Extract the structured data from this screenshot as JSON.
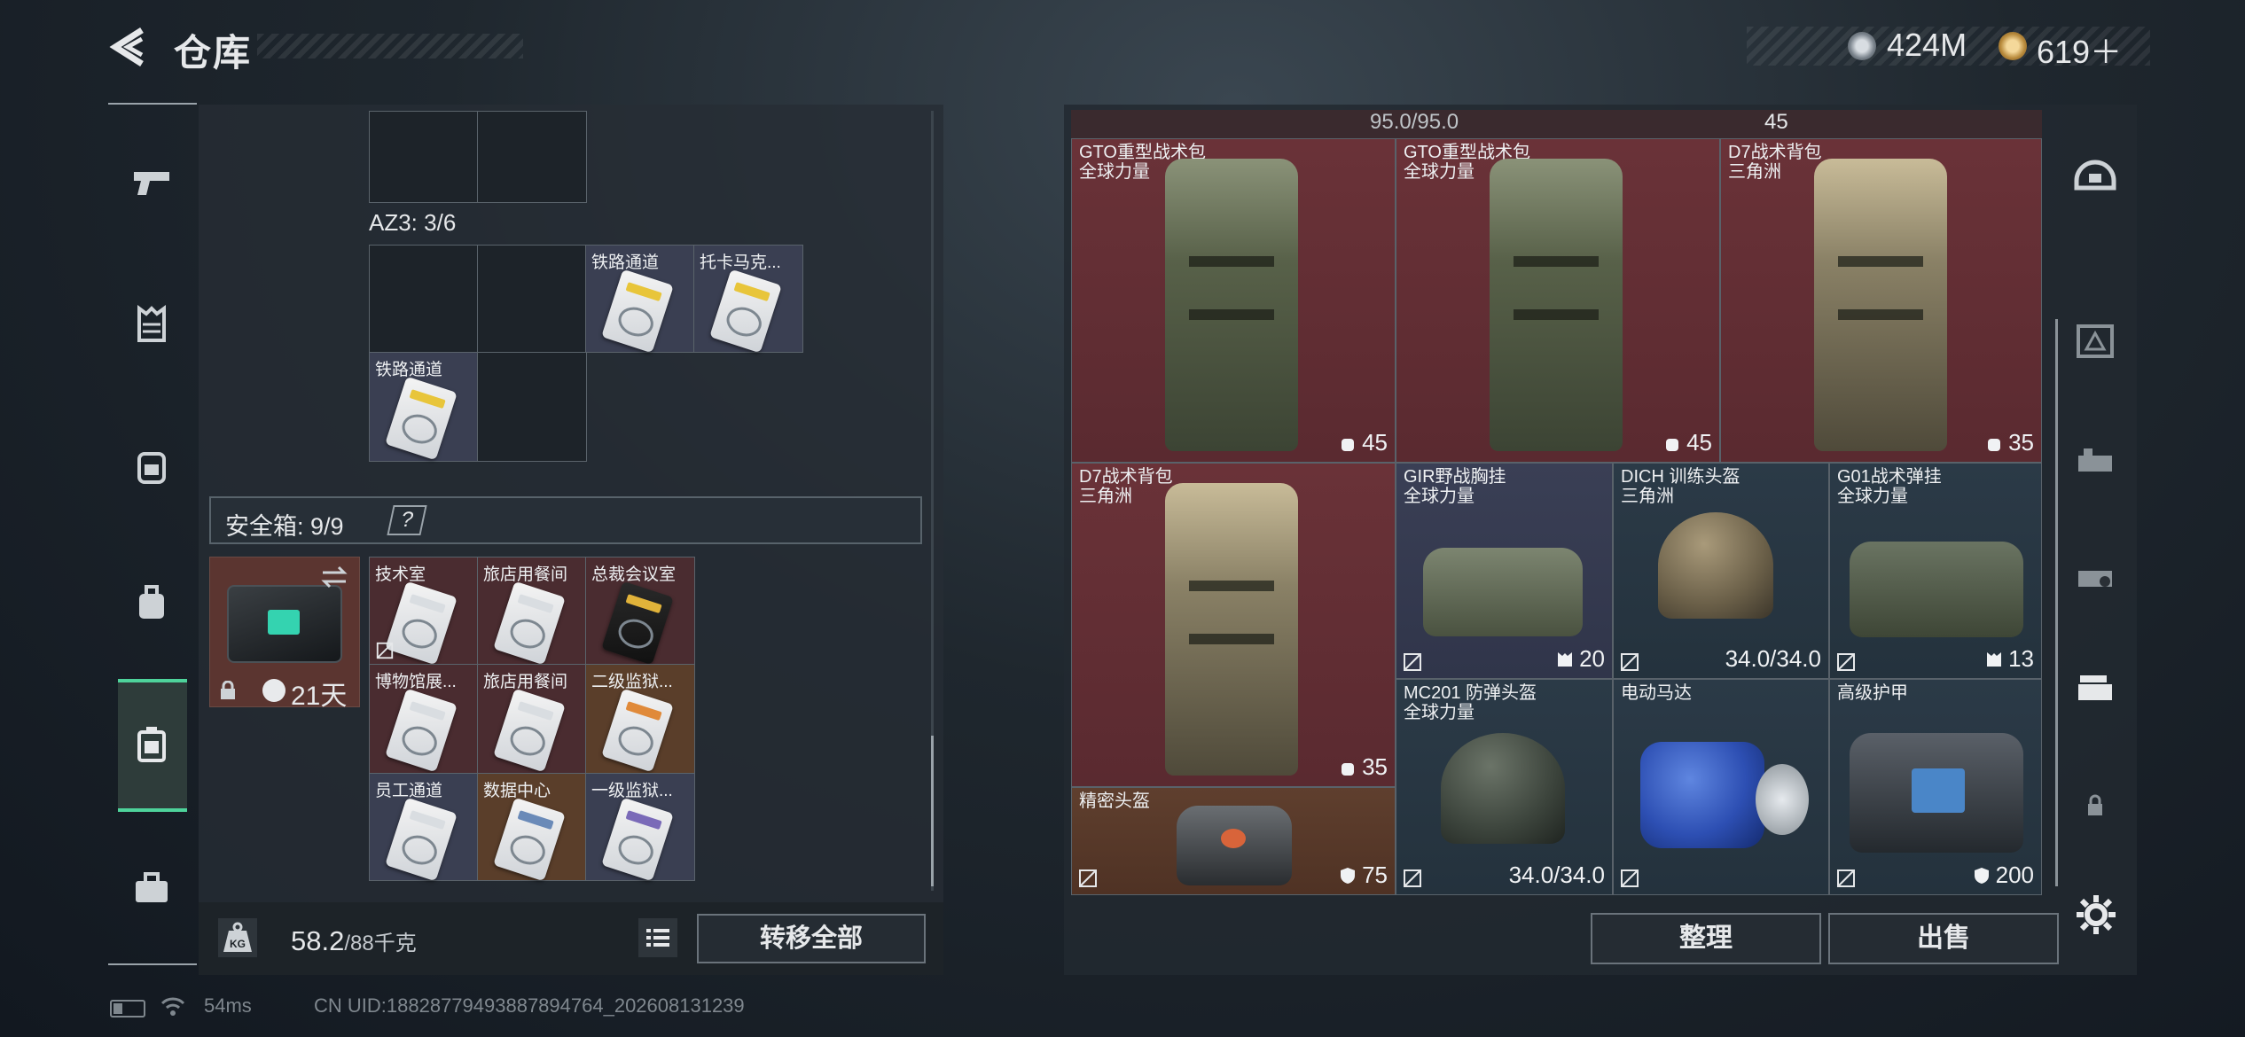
{
  "header": {
    "title": "仓库",
    "coin_silver": "424M",
    "coin_gold": "619＋"
  },
  "left": {
    "az3_label": "AZ3: 3/6",
    "az3_items": [
      {
        "label": "铁路通道"
      },
      {
        "label": "托卡马克..."
      },
      {
        "label": "铁路通道"
      }
    ],
    "safebox": {
      "label": "安全箱: 9/9",
      "help": "?",
      "days": "21天"
    },
    "safebox_items": [
      {
        "label": "技术室"
      },
      {
        "label": "旅店用餐间"
      },
      {
        "label": "总裁会议室"
      },
      {
        "label": "博物馆展..."
      },
      {
        "label": "旅店用餐间"
      },
      {
        "label": "二级监狱..."
      },
      {
        "label": "员工通道"
      },
      {
        "label": "数据中心"
      },
      {
        "label": "一级监狱..."
      }
    ],
    "weight": "58.2",
    "weight_max": "/88千克",
    "transfer_all": "转移全部"
  },
  "right": {
    "top_strip": {
      "durability": "95.0/95.0",
      "value": "45"
    },
    "items": [
      {
        "name": "GTO重型战术包",
        "sub": "全球力量",
        "value": "45"
      },
      {
        "name": "GTO重型战术包",
        "sub": "全球力量",
        "value": "45"
      },
      {
        "name": "D7战术背包",
        "sub": "三角洲",
        "value": "35"
      },
      {
        "name": "D7战术背包",
        "sub": "三角洲",
        "value": "35"
      },
      {
        "name": "GIR野战胸挂",
        "sub": "全球力量",
        "value": "20"
      },
      {
        "name": "DICH 训练头盔",
        "sub": "三角洲",
        "value": "34.0/34.0"
      },
      {
        "name": "G01战术弹挂",
        "sub": "全球力量",
        "value": "13"
      },
      {
        "name": "MC201 防弹头盔",
        "sub": "全球力量",
        "value": "34.0/34.0"
      },
      {
        "name": "电动马达",
        "sub": "",
        "value": ""
      },
      {
        "name": "高级护甲",
        "sub": "",
        "value": "200"
      },
      {
        "name": "精密头盔",
        "sub": "",
        "value": "75"
      }
    ],
    "organize": "整理",
    "sell": "出售"
  },
  "status": {
    "ping": "54ms",
    "uid": "CN UID:18828779493887894764_202608131239"
  },
  "colors": {
    "accent": "#4ed39b",
    "cell_red": "#6a3238",
    "cell_blue": "#3a3f55"
  },
  "icons": [
    "back-arrow-icon",
    "pistol-icon",
    "vest-icon",
    "backpack-icon",
    "bag-icon",
    "safebox-icon",
    "briefcase-icon",
    "gear-icon",
    "lock-icon",
    "clock-icon",
    "swap-icon",
    "no-trade-icon",
    "kg-icon",
    "list-icon",
    "helmet-icon",
    "armor-icon"
  ]
}
